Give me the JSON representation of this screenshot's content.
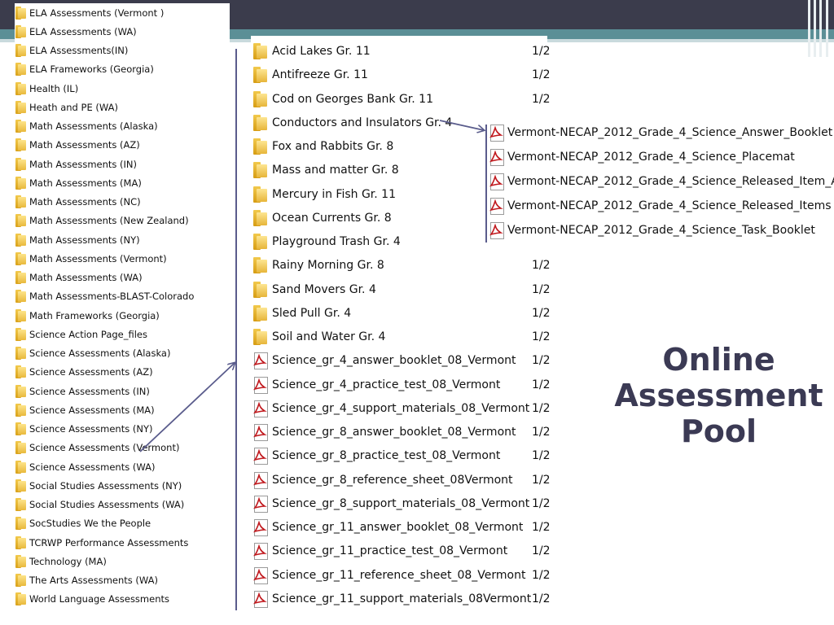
{
  "slide": {
    "title_lines": [
      "Online",
      "Assessment",
      "Pool"
    ],
    "colors": {
      "topbar": "#3b3c4c",
      "teal": "#5b8f96",
      "title": "#3b3a54",
      "arrow": "#5a5c8c"
    }
  },
  "left_folders": [
    "ELA Assessments (Vermont )",
    "ELA Assessments (WA)",
    "ELA Assessments(IN)",
    "ELA Frameworks (Georgia)",
    "Health (IL)",
    "Heath and PE (WA)",
    "Math Assessments (Alaska)",
    "Math Assessments (AZ)",
    "Math Assessments (IN)",
    "Math Assessments (MA)",
    "Math Assessments (NC)",
    "Math Assessments (New Zealand)",
    "Math Assessments (NY)",
    "Math Assessments (Vermont)",
    "Math Assessments (WA)",
    "Math Assessments-BLAST-Colorado",
    "Math Frameworks (Georgia)",
    "Science Action Page_files",
    "Science Assessments (Alaska)",
    "Science Assessments (AZ)",
    "Science Assessments (IN)",
    "Science Assessments (MA)",
    "Science Assessments (NY)",
    "Science Assessments (Vermont)",
    "Science Assessments (WA)",
    "Social Studies Assessments (NY)",
    "Social Studies Assessments (WA)",
    "SocStudies We the People",
    "TCRWP Performance Assessments",
    "Technology (MA)",
    "The Arts Assessments (WA)",
    "World Language Assessments"
  ],
  "middle_items": [
    {
      "name": "Acid Lakes Gr. 11",
      "type": "folder",
      "date": "1/2"
    },
    {
      "name": "Antifreeze Gr. 11",
      "type": "folder",
      "date": "1/2"
    },
    {
      "name": "Cod on Georges Bank Gr. 11",
      "type": "folder",
      "date": "1/2"
    },
    {
      "name": "Conductors and Insulators Gr. 4",
      "type": "folder",
      "date": ""
    },
    {
      "name": "Fox and Rabbits Gr. 8",
      "type": "folder",
      "date": ""
    },
    {
      "name": "Mass and matter Gr. 8",
      "type": "folder",
      "date": ""
    },
    {
      "name": "Mercury in Fish Gr. 11",
      "type": "folder",
      "date": ""
    },
    {
      "name": "Ocean Currents Gr. 8",
      "type": "folder",
      "date": ""
    },
    {
      "name": "Playground Trash Gr. 4",
      "type": "folder",
      "date": ""
    },
    {
      "name": "Rainy Morning Gr. 8",
      "type": "folder",
      "date": "1/2"
    },
    {
      "name": "Sand Movers Gr. 4",
      "type": "folder",
      "date": "1/2"
    },
    {
      "name": "Sled Pull Gr. 4",
      "type": "folder",
      "date": "1/2"
    },
    {
      "name": "Soil and Water Gr. 4",
      "type": "folder",
      "date": "1/2"
    },
    {
      "name": "Science_gr_4_answer_booklet_08_Vermont",
      "type": "pdf",
      "date": "1/2"
    },
    {
      "name": "Science_gr_4_practice_test_08_Vermont",
      "type": "pdf",
      "date": "1/2"
    },
    {
      "name": "Science_gr_4_support_materials_08_Vermont",
      "type": "pdf",
      "date": "1/2"
    },
    {
      "name": "Science_gr_8_answer_booklet_08_Vermont",
      "type": "pdf",
      "date": "1/2"
    },
    {
      "name": "Science_gr_8_practice_test_08_Vermont",
      "type": "pdf",
      "date": "1/2"
    },
    {
      "name": "Science_gr_8_reference_sheet_08Vermont",
      "type": "pdf",
      "date": "1/2"
    },
    {
      "name": "Science_gr_8_support_materials_08_Vermont",
      "type": "pdf",
      "date": "1/2"
    },
    {
      "name": "Science_gr_11_answer_booklet_08_Vermont",
      "type": "pdf",
      "date": "1/2"
    },
    {
      "name": "Science_gr_11_practice_test_08_Vermont",
      "type": "pdf",
      "date": "1/2"
    },
    {
      "name": "Science_gr_11_reference_sheet_08_Vermont",
      "type": "pdf",
      "date": "1/2"
    },
    {
      "name": "Science_gr_11_support_materials_08Vermont",
      "type": "pdf",
      "date": "1/2"
    }
  ],
  "right_files": [
    "Vermont-NECAP_2012_Grade_4_Science_Answer_Booklet",
    "Vermont-NECAP_2012_Grade_4_Science_Placemat",
    "Vermont-NECAP_2012_Grade_4_Science_Released_Item_A...",
    "Vermont-NECAP_2012_Grade_4_Science_Released_Items",
    "Vermont-NECAP_2012_Grade_4_Science_Task_Booklet"
  ]
}
